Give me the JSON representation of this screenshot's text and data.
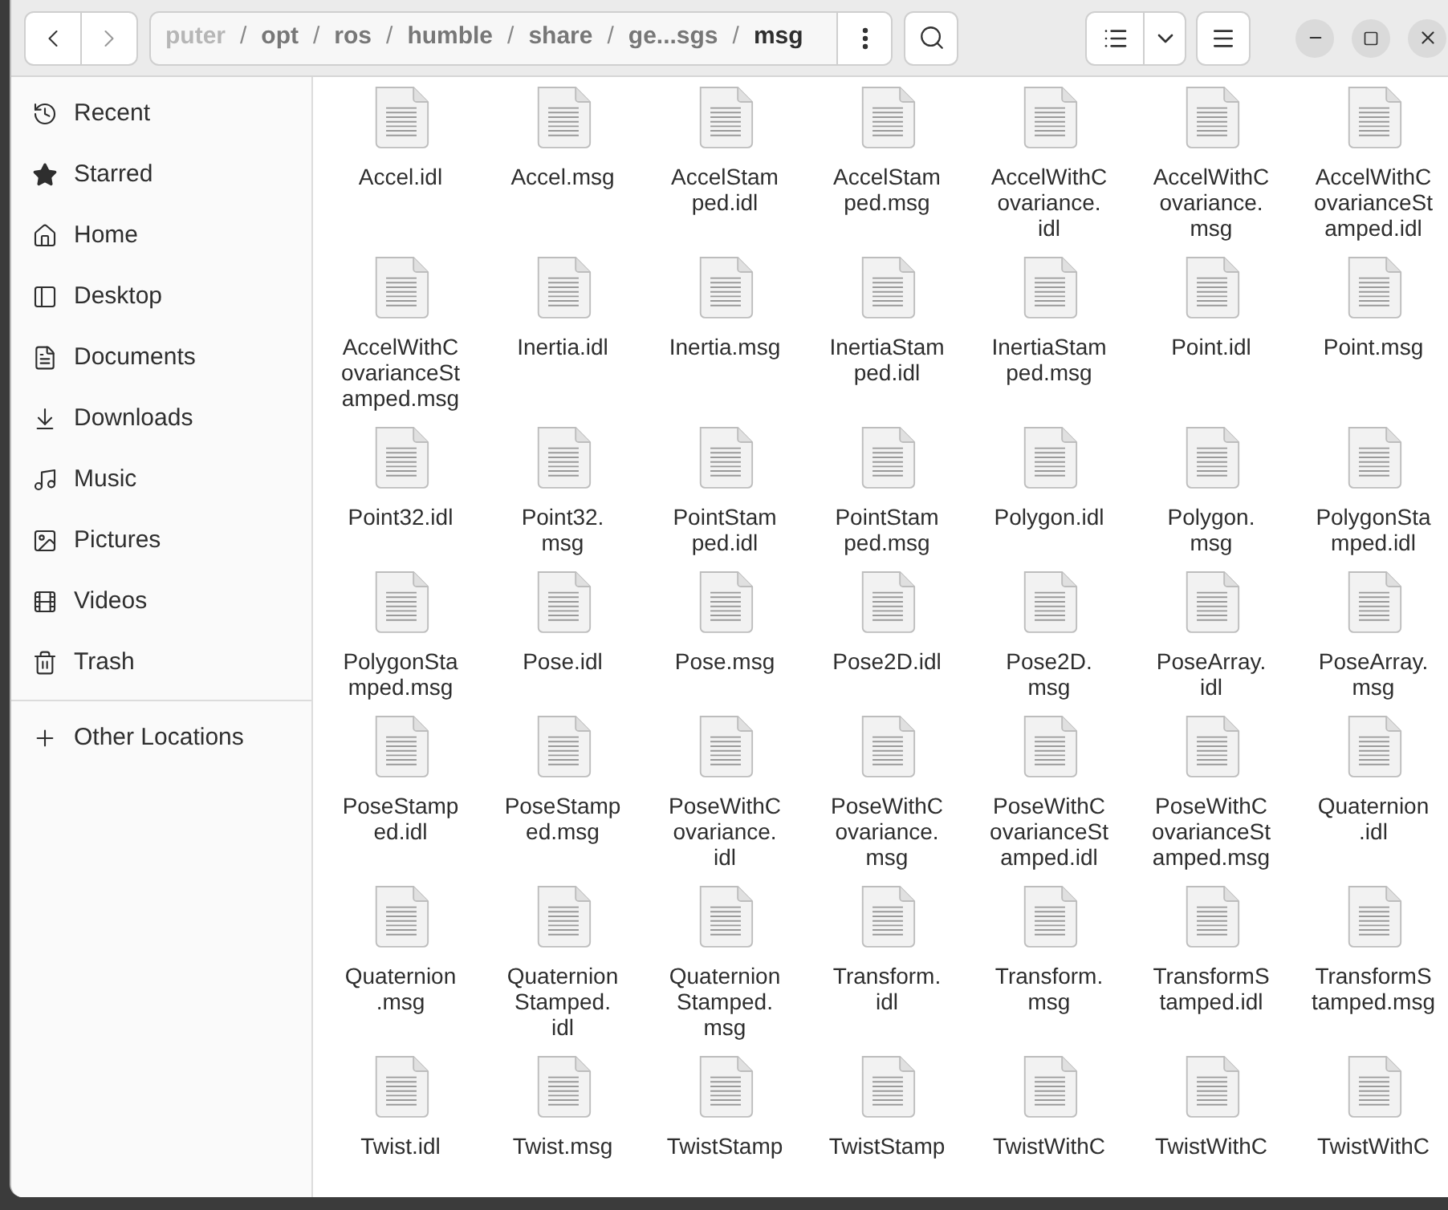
{
  "path_bar": {
    "separator": "/",
    "crumbs": [
      {
        "label": "puter",
        "selected": false,
        "faded": true
      },
      {
        "label": "opt",
        "selected": false,
        "faded": false
      },
      {
        "label": "ros",
        "selected": false,
        "faded": false
      },
      {
        "label": "humble",
        "selected": false,
        "faded": false
      },
      {
        "label": "share",
        "selected": false,
        "faded": false
      },
      {
        "label": "ge...sgs",
        "selected": false,
        "faded": false
      },
      {
        "label": "msg",
        "selected": true,
        "faded": false
      }
    ]
  },
  "sidebar": {
    "items": [
      {
        "kind": "recent",
        "label": "Recent"
      },
      {
        "kind": "starred",
        "label": "Starred"
      },
      {
        "kind": "home",
        "label": "Home"
      },
      {
        "kind": "desktop",
        "label": "Desktop"
      },
      {
        "kind": "documents",
        "label": "Documents"
      },
      {
        "kind": "downloads",
        "label": "Downloads"
      },
      {
        "kind": "music",
        "label": "Music"
      },
      {
        "kind": "pictures",
        "label": "Pictures"
      },
      {
        "kind": "videos",
        "label": "Videos"
      },
      {
        "kind": "trash",
        "label": "Trash"
      }
    ],
    "other": {
      "kind": "other",
      "label": "Other Locations"
    }
  },
  "files": [
    {
      "lines": [
        "Accel.idl"
      ]
    },
    {
      "lines": [
        "Accel.msg"
      ]
    },
    {
      "lines": [
        "AccelStam",
        "ped.idl"
      ]
    },
    {
      "lines": [
        "AccelStam",
        "ped.msg"
      ]
    },
    {
      "lines": [
        "AccelWithC",
        "ovariance.",
        "idl"
      ]
    },
    {
      "lines": [
        "AccelWithC",
        "ovariance.",
        "msg"
      ]
    },
    {
      "lines": [
        "AccelWithC",
        "ovarianceSt",
        "amped.idl"
      ]
    },
    {
      "lines": [
        "AccelWithC",
        "ovarianceSt",
        "amped.msg"
      ]
    },
    {
      "lines": [
        "Inertia.idl"
      ]
    },
    {
      "lines": [
        "Inertia.msg"
      ]
    },
    {
      "lines": [
        "InertiaStam",
        "ped.idl"
      ]
    },
    {
      "lines": [
        "InertiaStam",
        "ped.msg"
      ]
    },
    {
      "lines": [
        "Point.idl"
      ]
    },
    {
      "lines": [
        "Point.msg"
      ]
    },
    {
      "lines": [
        "Point32.idl"
      ]
    },
    {
      "lines": [
        "Point32.",
        "msg"
      ]
    },
    {
      "lines": [
        "PointStam",
        "ped.idl"
      ]
    },
    {
      "lines": [
        "PointStam",
        "ped.msg"
      ]
    },
    {
      "lines": [
        "Polygon.idl"
      ]
    },
    {
      "lines": [
        "Polygon.",
        "msg"
      ]
    },
    {
      "lines": [
        "PolygonSta",
        "mped.idl"
      ]
    },
    {
      "lines": [
        "PolygonSta",
        "mped.msg"
      ]
    },
    {
      "lines": [
        "Pose.idl"
      ]
    },
    {
      "lines": [
        "Pose.msg"
      ]
    },
    {
      "lines": [
        "Pose2D.idl"
      ]
    },
    {
      "lines": [
        "Pose2D.",
        "msg"
      ]
    },
    {
      "lines": [
        "PoseArray.",
        "idl"
      ]
    },
    {
      "lines": [
        "PoseArray.",
        "msg"
      ]
    },
    {
      "lines": [
        "PoseStamp",
        "ed.idl"
      ]
    },
    {
      "lines": [
        "PoseStamp",
        "ed.msg"
      ]
    },
    {
      "lines": [
        "PoseWithC",
        "ovariance.",
        "idl"
      ]
    },
    {
      "lines": [
        "PoseWithC",
        "ovariance.",
        "msg"
      ]
    },
    {
      "lines": [
        "PoseWithC",
        "ovarianceSt",
        "amped.idl"
      ]
    },
    {
      "lines": [
        "PoseWithC",
        "ovarianceSt",
        "amped.msg"
      ]
    },
    {
      "lines": [
        "Quaternion",
        ".idl"
      ]
    },
    {
      "lines": [
        "Quaternion",
        ".msg"
      ]
    },
    {
      "lines": [
        "Quaternion",
        "Stamped.",
        "idl"
      ]
    },
    {
      "lines": [
        "Quaternion",
        "Stamped.",
        "msg"
      ]
    },
    {
      "lines": [
        "Transform.",
        "idl"
      ]
    },
    {
      "lines": [
        "Transform.",
        "msg"
      ]
    },
    {
      "lines": [
        "TransformS",
        "tamped.idl"
      ]
    },
    {
      "lines": [
        "TransformS",
        "tamped.msg"
      ]
    },
    {
      "lines": [
        "Twist.idl"
      ]
    },
    {
      "lines": [
        "Twist.msg"
      ]
    },
    {
      "lines": [
        "TwistStamp"
      ]
    },
    {
      "lines": [
        "TwistStamp"
      ]
    },
    {
      "lines": [
        "TwistWithC"
      ]
    },
    {
      "lines": [
        "TwistWithC"
      ]
    },
    {
      "lines": [
        "TwistWithC"
      ]
    }
  ]
}
